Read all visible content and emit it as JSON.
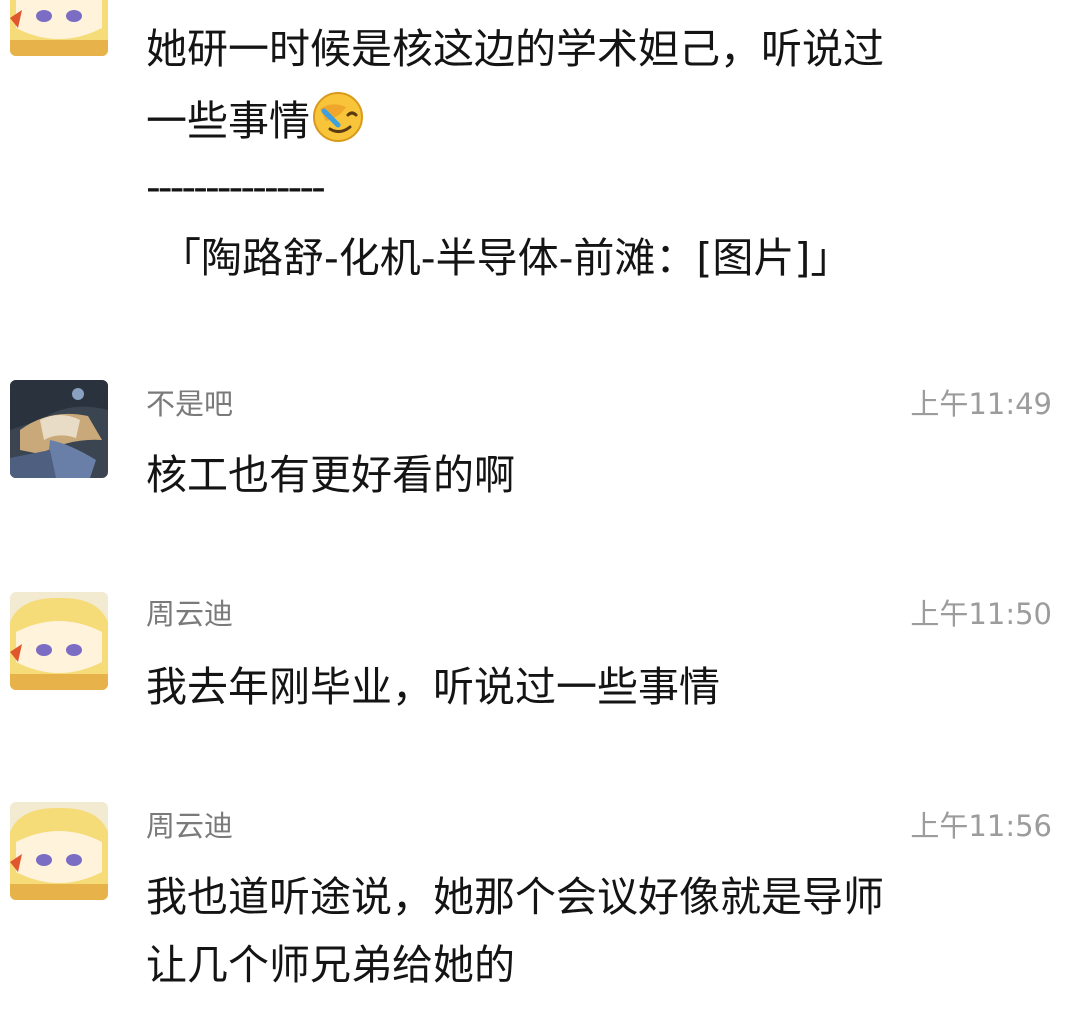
{
  "messages": [
    {
      "author": "",
      "time": "",
      "avatar": "anime-blonde-avatar",
      "lines": [
        "她研一时候是核这边的学术妲己，听说过",
        "一些事情"
      ],
      "emoji": "facepalm-crying-emoji",
      "divider": "---------------",
      "quote": "「陶路舒-化机-半导体-前滩：[图片]」"
    },
    {
      "author": "不是吧",
      "time": "上午11:49",
      "avatar": "anime-sleeping-avatar",
      "lines": [
        "核工也有更好看的啊"
      ]
    },
    {
      "author": "周云迪",
      "time": "上午11:50",
      "avatar": "anime-blonde-avatar",
      "lines": [
        "我去年刚毕业，听说过一些事情"
      ]
    },
    {
      "author": "周云迪",
      "time": "上午11:56",
      "avatar": "anime-blonde-avatar",
      "lines": [
        "我也道听途说，她那个会议好像就是导师",
        "让几个师兄弟给她的"
      ]
    }
  ],
  "colors": {
    "background": "#ffffff",
    "text": "#141414",
    "name": "#7a7a7a",
    "time": "#9c9c9c"
  }
}
